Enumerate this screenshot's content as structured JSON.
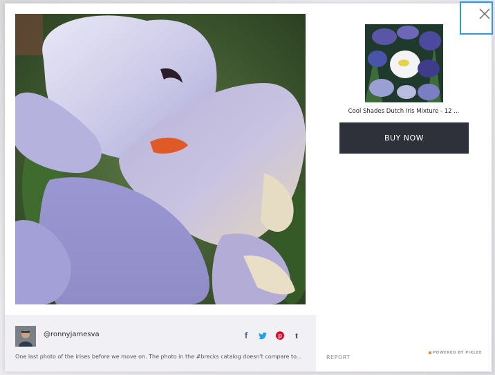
{
  "lightbox": {
    "username": "@ronnyjamesva",
    "caption": "One last photo of the irises before we move on. The photo in the #brecks catalog doesn't compare to...",
    "share": {
      "facebook_glyph": "f",
      "twitter_glyph": "🐦",
      "pinterest_glyph": "P",
      "tumblr_glyph": "t"
    },
    "icons": [
      "facebook-icon",
      "twitter-icon",
      "pinterest-icon",
      "tumblr-icon",
      "close-icon"
    ],
    "report_label": "REPORT",
    "powered_by": "POWERED BY PIXLEE"
  },
  "product": {
    "title": "Cool Shades Dutch Iris Mixture - 12 ...",
    "buy_label": "BUY NOW"
  },
  "colors": {
    "buy_button": "#2e303a",
    "close_focus": "#2f9be3",
    "pinterest": "#e60023",
    "facebook": "#3b5998",
    "twitter": "#1da1f2"
  }
}
